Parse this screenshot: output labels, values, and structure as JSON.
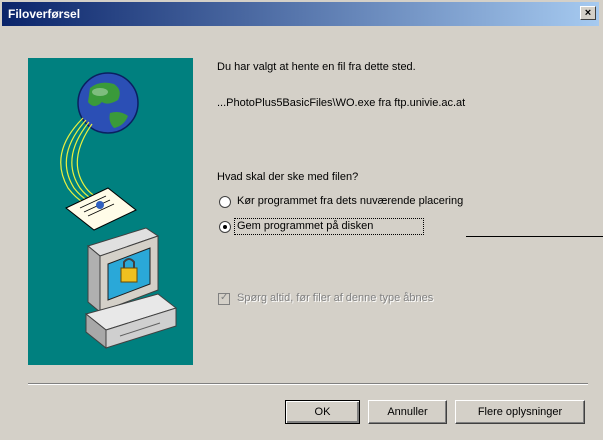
{
  "window": {
    "title": "Filoverførsel",
    "close_glyph": "×"
  },
  "message": {
    "line1": "Du har valgt at hente en fil fra dette sted.",
    "line2": "...PhotoPlus5BasicFiles\\WO.exe fra ftp.univie.ac.at"
  },
  "question": "Hvad skal der ske med filen?",
  "options": [
    {
      "label": "Kør programmet fra dets nuværende placering",
      "selected": false
    },
    {
      "label": "Gem programmet på disken",
      "selected": true
    }
  ],
  "checkbox": {
    "label": "Spørg altid, før filer af denne type åbnes",
    "checked": true,
    "disabled": true
  },
  "buttons": {
    "ok": "OK",
    "cancel": "Annuller",
    "more_info": "Flere oplysninger"
  },
  "colors": {
    "illustration_bg": "#00807f",
    "title_start": "#0a246a"
  },
  "icons": [
    "globe-icon",
    "document-icon",
    "padlock-computer-icon"
  ]
}
